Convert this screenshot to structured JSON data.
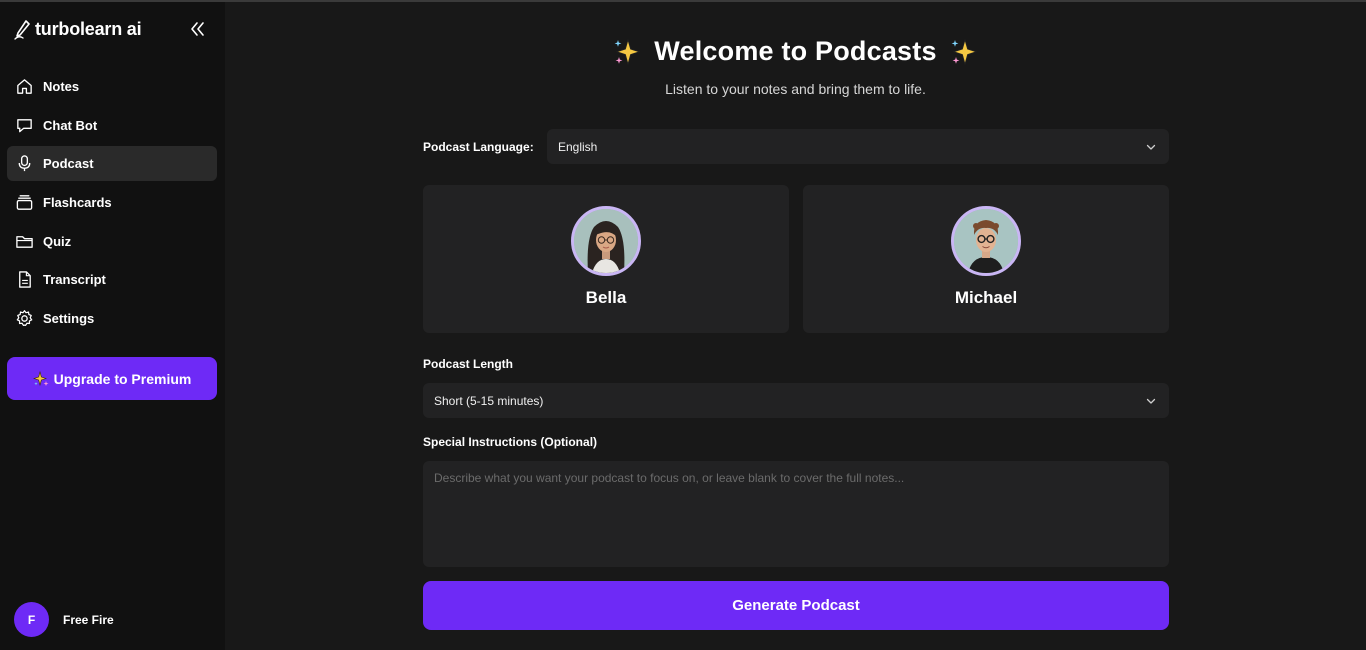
{
  "app": {
    "brand": "turbolearn ai"
  },
  "sidebar": {
    "items": [
      {
        "label": "Notes",
        "icon": "home-icon"
      },
      {
        "label": "Chat Bot",
        "icon": "chat-bubble-icon"
      },
      {
        "label": "Podcast",
        "icon": "microphone-icon",
        "active": true
      },
      {
        "label": "Flashcards",
        "icon": "cards-stack-icon"
      },
      {
        "label": "Quiz",
        "icon": "folder-icon"
      },
      {
        "label": "Transcript",
        "icon": "document-icon"
      },
      {
        "label": "Settings",
        "icon": "gear-icon"
      }
    ],
    "upgrade_label": "Upgrade to Premium",
    "user": {
      "initial": "F",
      "name": "Free Fire"
    }
  },
  "main": {
    "title": "Welcome to Podcasts",
    "subtitle": "Listen to your notes and bring them to life.",
    "language": {
      "label": "Podcast Language:",
      "value": "English"
    },
    "hosts": [
      {
        "name": "Bella"
      },
      {
        "name": "Michael"
      }
    ],
    "length": {
      "label": "Podcast Length",
      "value": "Short (5-15 minutes)"
    },
    "instructions": {
      "label": "Special Instructions (Optional)",
      "placeholder": "Describe what you want your podcast to focus on, or leave blank to cover the full notes...",
      "value": ""
    },
    "generate_label": "Generate Podcast"
  },
  "colors": {
    "accent": "#6e2af6",
    "background": "#181818",
    "sidebar": "#111111",
    "card": "#222223"
  }
}
